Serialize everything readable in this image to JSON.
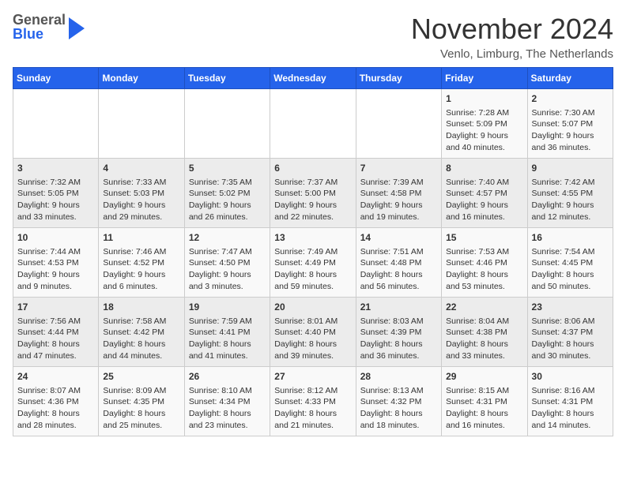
{
  "logo": {
    "general": "General",
    "blue": "Blue"
  },
  "header": {
    "month": "November 2024",
    "location": "Venlo, Limburg, The Netherlands"
  },
  "days_of_week": [
    "Sunday",
    "Monday",
    "Tuesday",
    "Wednesday",
    "Thursday",
    "Friday",
    "Saturday"
  ],
  "weeks": [
    [
      {
        "day": "",
        "info": ""
      },
      {
        "day": "",
        "info": ""
      },
      {
        "day": "",
        "info": ""
      },
      {
        "day": "",
        "info": ""
      },
      {
        "day": "",
        "info": ""
      },
      {
        "day": "1",
        "info": "Sunrise: 7:28 AM\nSunset: 5:09 PM\nDaylight: 9 hours and 40 minutes."
      },
      {
        "day": "2",
        "info": "Sunrise: 7:30 AM\nSunset: 5:07 PM\nDaylight: 9 hours and 36 minutes."
      }
    ],
    [
      {
        "day": "3",
        "info": "Sunrise: 7:32 AM\nSunset: 5:05 PM\nDaylight: 9 hours and 33 minutes."
      },
      {
        "day": "4",
        "info": "Sunrise: 7:33 AM\nSunset: 5:03 PM\nDaylight: 9 hours and 29 minutes."
      },
      {
        "day": "5",
        "info": "Sunrise: 7:35 AM\nSunset: 5:02 PM\nDaylight: 9 hours and 26 minutes."
      },
      {
        "day": "6",
        "info": "Sunrise: 7:37 AM\nSunset: 5:00 PM\nDaylight: 9 hours and 22 minutes."
      },
      {
        "day": "7",
        "info": "Sunrise: 7:39 AM\nSunset: 4:58 PM\nDaylight: 9 hours and 19 minutes."
      },
      {
        "day": "8",
        "info": "Sunrise: 7:40 AM\nSunset: 4:57 PM\nDaylight: 9 hours and 16 minutes."
      },
      {
        "day": "9",
        "info": "Sunrise: 7:42 AM\nSunset: 4:55 PM\nDaylight: 9 hours and 12 minutes."
      }
    ],
    [
      {
        "day": "10",
        "info": "Sunrise: 7:44 AM\nSunset: 4:53 PM\nDaylight: 9 hours and 9 minutes."
      },
      {
        "day": "11",
        "info": "Sunrise: 7:46 AM\nSunset: 4:52 PM\nDaylight: 9 hours and 6 minutes."
      },
      {
        "day": "12",
        "info": "Sunrise: 7:47 AM\nSunset: 4:50 PM\nDaylight: 9 hours and 3 minutes."
      },
      {
        "day": "13",
        "info": "Sunrise: 7:49 AM\nSunset: 4:49 PM\nDaylight: 8 hours and 59 minutes."
      },
      {
        "day": "14",
        "info": "Sunrise: 7:51 AM\nSunset: 4:48 PM\nDaylight: 8 hours and 56 minutes."
      },
      {
        "day": "15",
        "info": "Sunrise: 7:53 AM\nSunset: 4:46 PM\nDaylight: 8 hours and 53 minutes."
      },
      {
        "day": "16",
        "info": "Sunrise: 7:54 AM\nSunset: 4:45 PM\nDaylight: 8 hours and 50 minutes."
      }
    ],
    [
      {
        "day": "17",
        "info": "Sunrise: 7:56 AM\nSunset: 4:44 PM\nDaylight: 8 hours and 47 minutes."
      },
      {
        "day": "18",
        "info": "Sunrise: 7:58 AM\nSunset: 4:42 PM\nDaylight: 8 hours and 44 minutes."
      },
      {
        "day": "19",
        "info": "Sunrise: 7:59 AM\nSunset: 4:41 PM\nDaylight: 8 hours and 41 minutes."
      },
      {
        "day": "20",
        "info": "Sunrise: 8:01 AM\nSunset: 4:40 PM\nDaylight: 8 hours and 39 minutes."
      },
      {
        "day": "21",
        "info": "Sunrise: 8:03 AM\nSunset: 4:39 PM\nDaylight: 8 hours and 36 minutes."
      },
      {
        "day": "22",
        "info": "Sunrise: 8:04 AM\nSunset: 4:38 PM\nDaylight: 8 hours and 33 minutes."
      },
      {
        "day": "23",
        "info": "Sunrise: 8:06 AM\nSunset: 4:37 PM\nDaylight: 8 hours and 30 minutes."
      }
    ],
    [
      {
        "day": "24",
        "info": "Sunrise: 8:07 AM\nSunset: 4:36 PM\nDaylight: 8 hours and 28 minutes."
      },
      {
        "day": "25",
        "info": "Sunrise: 8:09 AM\nSunset: 4:35 PM\nDaylight: 8 hours and 25 minutes."
      },
      {
        "day": "26",
        "info": "Sunrise: 8:10 AM\nSunset: 4:34 PM\nDaylight: 8 hours and 23 minutes."
      },
      {
        "day": "27",
        "info": "Sunrise: 8:12 AM\nSunset: 4:33 PM\nDaylight: 8 hours and 21 minutes."
      },
      {
        "day": "28",
        "info": "Sunrise: 8:13 AM\nSunset: 4:32 PM\nDaylight: 8 hours and 18 minutes."
      },
      {
        "day": "29",
        "info": "Sunrise: 8:15 AM\nSunset: 4:31 PM\nDaylight: 8 hours and 16 minutes."
      },
      {
        "day": "30",
        "info": "Sunrise: 8:16 AM\nSunset: 4:31 PM\nDaylight: 8 hours and 14 minutes."
      }
    ]
  ]
}
